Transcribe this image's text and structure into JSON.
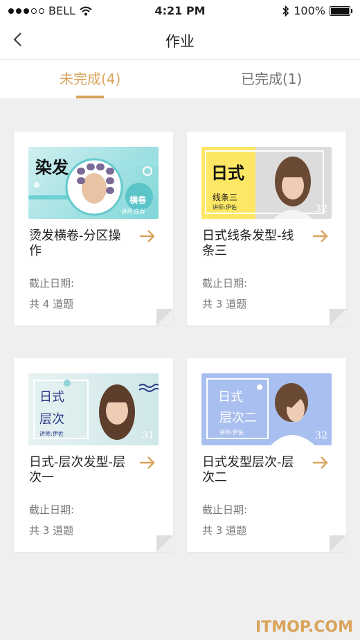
{
  "status": {
    "carrier": "BELL",
    "time": "4:21 PM",
    "battery": "100%"
  },
  "nav": {
    "title": "作业"
  },
  "tabs": [
    {
      "label": "未完成(4)",
      "active": true
    },
    {
      "label": "已完成(1)",
      "active": false
    }
  ],
  "cards": [
    {
      "title": "烫发横卷-分区操作",
      "deadline": "截止日期:",
      "count": "共 4 道题",
      "thumb_title": "染发",
      "thumb_sub": "横卷",
      "thumb_teacher": "讲师:庄群"
    },
    {
      "title": "日式线条发型-线条三",
      "deadline": "截止日期:",
      "count": "共 3 道题",
      "thumb_title": "日式",
      "thumb_sub": "线条三",
      "thumb_teacher": "讲师:伊佐",
      "thumb_num": "32"
    },
    {
      "title": "日式-层次发型-层次一",
      "deadline": "截止日期:",
      "count": "共 3 道题",
      "thumb_title": "日式",
      "thumb_sub": "层次",
      "thumb_teacher": "讲师:伊佐",
      "thumb_num": "31"
    },
    {
      "title": "日式发型层次-层次二",
      "deadline": "截止日期:",
      "count": "共 3 道题",
      "thumb_title": "日式",
      "thumb_sub": "层次二",
      "thumb_teacher": "讲师:伊佐",
      "thumb_num": "32"
    }
  ],
  "watermark": "ITMOP.COM",
  "colors": {
    "accent": "#d9a35a",
    "bg": "#efefef"
  }
}
